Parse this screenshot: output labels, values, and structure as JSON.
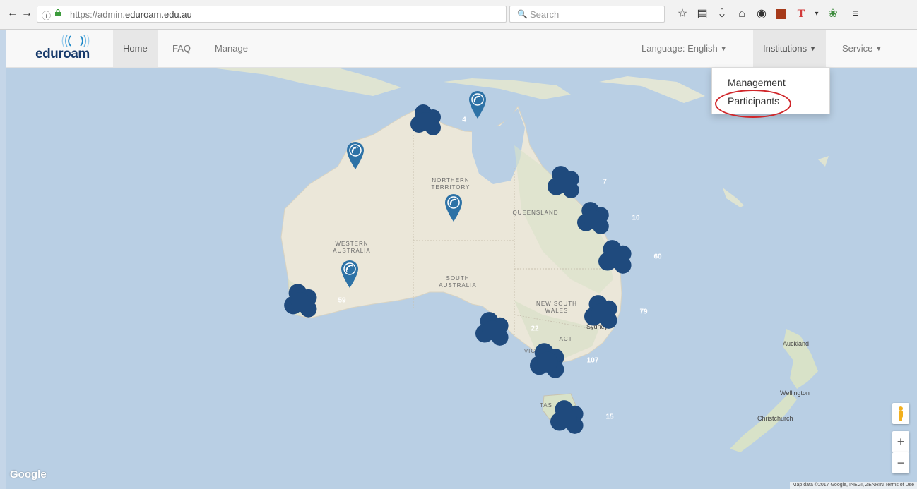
{
  "browser": {
    "url_scheme": "https://admin.",
    "url_domain": "eduroam.edu.au",
    "search_placeholder": "Search"
  },
  "navbar": {
    "brand": "eduroam",
    "items": [
      {
        "label": "Home"
      },
      {
        "label": "FAQ"
      },
      {
        "label": "Manage"
      },
      {
        "label": "Language: English"
      },
      {
        "label": "Institutions"
      },
      {
        "label": "Service"
      }
    ]
  },
  "dropdown": {
    "items": [
      {
        "label": "Management"
      },
      {
        "label": "Participants"
      }
    ]
  },
  "map": {
    "region_labels": {
      "nt": "NORTHERN TERRITORY",
      "wa": "WESTERN AUSTRALIA",
      "qld": "QUEENSLAND",
      "sa": "SOUTH AUSTRALIA",
      "nsw": "NEW SOUTH WALES",
      "act": "ACT",
      "vic": "VIC",
      "tas": "TAS"
    },
    "cities": {
      "sydney": "Sydney",
      "auckland": "Auckland",
      "wellington": "Wellington",
      "christchurch": "Christchurch"
    },
    "clusters": [
      {
        "id": "darwin",
        "count": "4"
      },
      {
        "id": "cairns",
        "count": "7"
      },
      {
        "id": "townsville",
        "count": "10"
      },
      {
        "id": "brisbane",
        "count": "60"
      },
      {
        "id": "perth",
        "count": "59"
      },
      {
        "id": "sydney",
        "count": "79"
      },
      {
        "id": "adelaide",
        "count": "22"
      },
      {
        "id": "melbourne",
        "count": "107"
      },
      {
        "id": "hobart",
        "count": "15"
      }
    ],
    "zoom_in": "+",
    "zoom_out": "−",
    "logo": "Google",
    "attribution": "Map data ©2017 Google, INEGI, ZENRIN   Terms of Use"
  },
  "colors": {
    "ocean": "#b9cfe4",
    "land": "#e8e6dc",
    "marker": "#1f4a7d",
    "highlight_circle": "#d0262a"
  }
}
